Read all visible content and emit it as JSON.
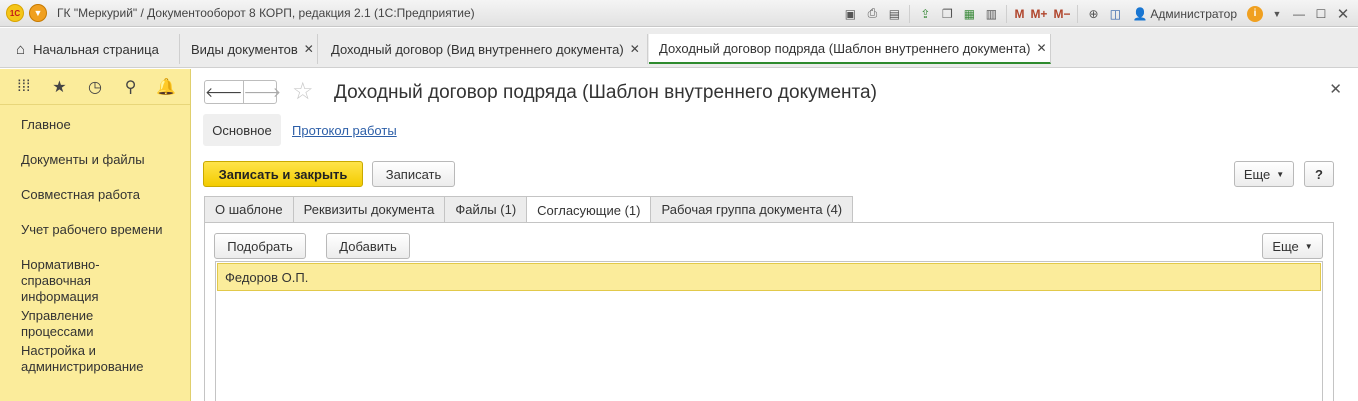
{
  "titlebar": {
    "title": "ГК \"Меркурий\" / Документооборот 8 КОРП, редакция 2.1  (1С:Предприятие)",
    "logo_text": "1С",
    "m_label": "M",
    "m_plus_label": "M+",
    "m_minus_label": "M−",
    "user": "Администратор"
  },
  "tabs": [
    {
      "label": "Начальная страница"
    },
    {
      "label": "Виды документов"
    },
    {
      "label": "Доходный договор (Вид внутреннего документа)"
    },
    {
      "label": "Доходный договор подряда (Шаблон внутреннего документа)"
    }
  ],
  "sidebar": {
    "items": [
      {
        "label": "Главное"
      },
      {
        "label": "Документы и файлы"
      },
      {
        "label": "Совместная работа"
      },
      {
        "label": "Учет рабочего времени"
      },
      {
        "label": "Нормативно-справочная информация"
      },
      {
        "label": "Управление процессами"
      },
      {
        "label": "Настройка и администрирование"
      }
    ]
  },
  "form": {
    "title": "Доходный договор подряда (Шаблон внутреннего документа)",
    "subnav_main": "Основное",
    "subnav_link": "Протокол работы",
    "save_close": "Записать и закрыть",
    "save": "Записать",
    "more": "Еще",
    "help": "?",
    "tabs": [
      {
        "label": "О шаблоне"
      },
      {
        "label": "Реквизиты документа"
      },
      {
        "label": "Файлы (1)"
      },
      {
        "label": "Согласующие (1)"
      },
      {
        "label": "Рабочая группа документа (4)"
      }
    ],
    "pick": "Подобрать",
    "add": "Добавить",
    "list_more": "Еще",
    "rows": [
      {
        "name": "Федоров О.П."
      }
    ]
  }
}
